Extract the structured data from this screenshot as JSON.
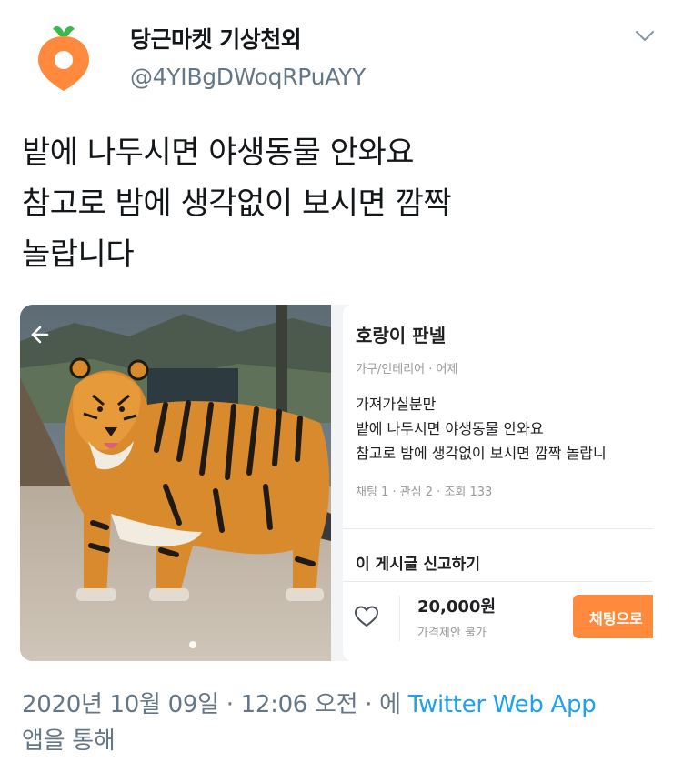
{
  "tweet": {
    "display_name": "당근마켓 기상천외",
    "handle": "@4YIBgDWoqRPuAYY",
    "text_lines": [
      "밭에 나두시면 야생동물 안와요",
      "참고로  밤에  생각없이  보시면  깜짝",
      "놀랍니다"
    ],
    "timestamp": "2020년 10월 09일 · 12:06 오전 · 에",
    "via_app": "Twitter Web App",
    "via_suffix": "앱을 통해"
  },
  "listing": {
    "title": "호랑이 판넬",
    "meta": "가구/인테리어 · 어제",
    "description": [
      "가져가실분만",
      "밭에  나두시면 야생동물 안와요",
      "참고로  밤에  생각없이  보시면  깜짝  놀랍니"
    ],
    "stats": "채팅 1 · 관심 2 · 조회 133",
    "report_label": "이 게시글 신고하기",
    "price": "20,000원",
    "negotiation": "가격제안 불가",
    "chat_button": "채팅으로"
  },
  "icons": {
    "avatar": "carrot-logo-icon",
    "menu": "chevron-down-icon",
    "back": "arrow-left-icon",
    "like": "heart-icon"
  },
  "colors": {
    "brand_orange": "#ff8a3d",
    "link_blue": "#1da1f2",
    "secondary_text": "#657786"
  }
}
